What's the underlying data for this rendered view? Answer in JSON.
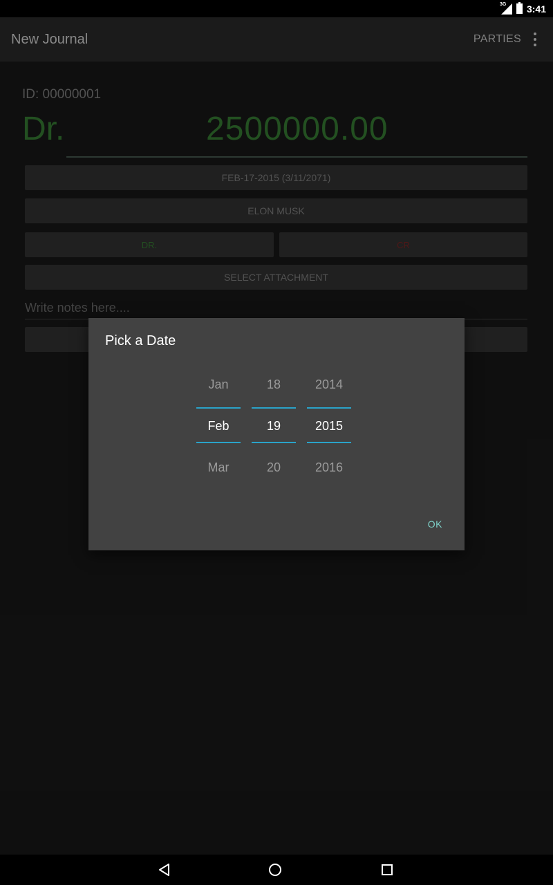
{
  "status_bar": {
    "time": "3:41",
    "network": "3G"
  },
  "app_bar": {
    "title": "New Journal",
    "parties_label": "PARTIES"
  },
  "form": {
    "id_text": "ID: 00000001",
    "dr_label": "Dr.",
    "amount": "2500000.00",
    "date_button": "FEB-17-2015 (3/11/2071)",
    "party_button": "ELON MUSK",
    "dr_button": "DR.",
    "cr_button": "CR",
    "attachment_button": "SELECT ATTACHMENT",
    "notes_placeholder": "Write notes here...."
  },
  "colors": {
    "dr_green": "#2f6b2c",
    "cr_red": "#6b1f1f",
    "accent": "#2aa3c9",
    "ok_text": "#7ed1c8"
  },
  "dialog": {
    "title": "Pick a Date",
    "month": {
      "prev": "Jan",
      "selected": "Feb",
      "next": "Mar"
    },
    "day": {
      "prev": "18",
      "selected": "19",
      "next": "20"
    },
    "year": {
      "prev": "2014",
      "selected": "2015",
      "next": "2016"
    },
    "ok_label": "OK"
  }
}
